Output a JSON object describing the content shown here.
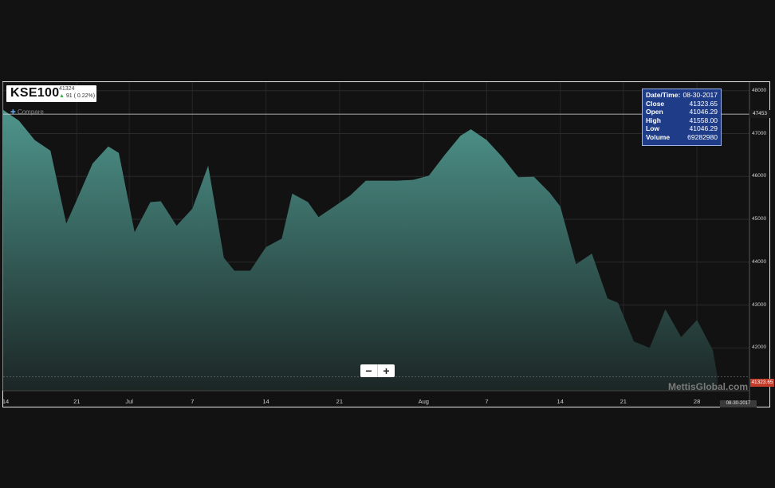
{
  "symbol_box": {
    "symbol": "KSE100",
    "last": "41324",
    "change_arrow": "▲",
    "change": "91 ( 0.22%)"
  },
  "compare_label": "Compare",
  "tooltip": {
    "rows": [
      {
        "k": "Date/Time:",
        "v": "08-30-2017"
      },
      {
        "k": "Close",
        "v": "41323.65"
      },
      {
        "k": "Open",
        "v": "41046.29"
      },
      {
        "k": "High",
        "v": "41558.00"
      },
      {
        "k": "Low",
        "v": "41046.29"
      },
      {
        "k": "Volume",
        "v": "69282980"
      }
    ]
  },
  "zoom": {
    "minus": "−",
    "plus": "+"
  },
  "watermark": "MettisGlobal.com",
  "crosshair_label": "47453",
  "current_label": "41323.65",
  "date_label": "08-30-2017",
  "colors": {
    "fill_top": "#4e958c",
    "fill_bottom": "#1b2625",
    "current": "#c43c2a",
    "tooltip_bg": "#1f3c88"
  },
  "chart_data": {
    "type": "area",
    "title": "",
    "y_ticks": [
      42000,
      43000,
      44000,
      45000,
      46000,
      47000,
      48000
    ],
    "ylim": [
      41000,
      48200
    ],
    "x_ticks": [
      {
        "label": "14",
        "x": 0
      },
      {
        "label": "21",
        "x": 7
      },
      {
        "label": "Jul",
        "x": 12
      },
      {
        "label": "7",
        "x": 18
      },
      {
        "label": "14",
        "x": 25
      },
      {
        "label": "21",
        "x": 32
      },
      {
        "label": "Aug",
        "x": 40
      },
      {
        "label": "7",
        "x": 46
      },
      {
        "label": "14",
        "x": 53
      },
      {
        "label": "21",
        "x": 59
      },
      {
        "label": "28",
        "x": 66
      }
    ],
    "xlim": [
      0,
      71
    ],
    "series": [
      {
        "x": [
          0,
          1.5,
          3,
          4.5,
          6,
          7,
          8.5,
          10,
          11,
          12.5,
          14,
          15,
          16.5,
          18,
          19.5,
          21,
          22,
          23.5,
          25,
          26.5,
          27.5,
          29,
          30,
          31.5,
          33,
          34.5,
          36,
          37.5,
          39,
          40.5,
          42,
          43.5,
          44.5,
          46,
          47.5,
          49,
          50.5,
          52,
          53,
          54.5,
          56,
          57.5,
          58.5,
          60,
          61.5,
          63,
          64.5,
          66,
          67.5
        ],
        "values": [
          47550,
          47300,
          46850,
          46600,
          44900,
          45450,
          46300,
          46700,
          46550,
          44700,
          45400,
          45420,
          44850,
          45250,
          46250,
          44100,
          43800,
          43800,
          44350,
          44550,
          45600,
          45400,
          45050,
          45300,
          45550,
          45900,
          45900,
          45900,
          45920,
          46020,
          46500,
          46950,
          47100,
          46850,
          46450,
          45980,
          45990,
          45620,
          45300,
          43950,
          44200,
          43150,
          43050,
          42150,
          42000,
          42900,
          42250,
          42650,
          41950
        ]
      }
    ],
    "crosshair_y": 47453,
    "current_value": 41323.65
  }
}
